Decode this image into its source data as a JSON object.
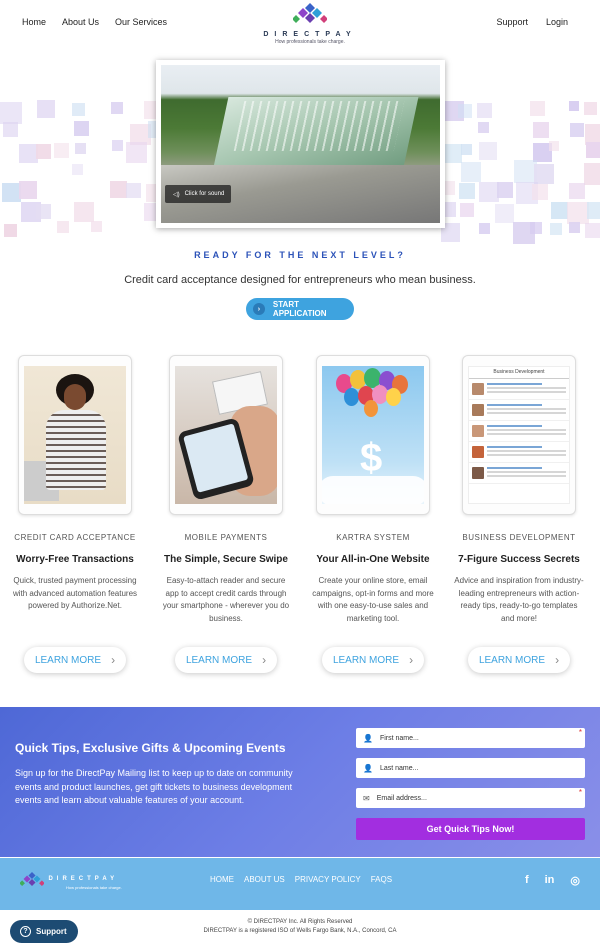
{
  "nav": {
    "left": [
      "Home",
      "About Us",
      "Our Services"
    ],
    "right": [
      "Support",
      "Login"
    ]
  },
  "logo": {
    "name": "DIRECTPAY",
    "tagline": "How professionals take charge."
  },
  "hero": {
    "sound_label": "Click for sound"
  },
  "tagline": {
    "ready": "READY FOR THE NEXT LEVEL?",
    "subhead": "Credit card acceptance designed for entrepreneurs who mean business.",
    "cta": "START APPLICATION"
  },
  "services": [
    {
      "category": "CREDIT CARD ACCEPTANCE",
      "title": "Worry-Free Transactions",
      "desc": "Quick, trusted payment processing with advanced automation features powered by Authorize.Net.",
      "button": "LEARN MORE"
    },
    {
      "category": "MOBILE PAYMENTS",
      "title": "The Simple, Secure Swipe",
      "desc": "Easy-to-attach reader and secure app to accept credit cards through your smartphone - wherever you do business.",
      "button": "LEARN MORE"
    },
    {
      "category": "KARTRA SYSTEM",
      "title": "Your All-in-One Website",
      "desc": "Create your online store, email campaigns, opt-in forms and more with one easy-to-use sales and marketing tool.",
      "button": "LEARN MORE"
    },
    {
      "category": "BUSINESS DEVELOPMENT",
      "title": "7-Figure Success Secrets",
      "desc": "Advice and inspiration from industry-leading entrepreneurs with action-ready tips, ready-to-go templates and more!",
      "button": "LEARN MORE"
    }
  ],
  "blog_preview_title": "Business Development",
  "newsletter": {
    "title": "Quick Tips, Exclusive Gifts & Upcoming Events",
    "text": "Sign up for the DirectPay Mailing list to keep up to date on community events and product launches, get gift tickets to business development events and learn about valuable features of your account.",
    "first_name": "First name...",
    "last_name": "Last name...",
    "email": "Email address...",
    "submit": "Get Quick Tips Now!"
  },
  "footer": {
    "links": [
      "HOME",
      "ABOUT US",
      "PRIVACY POLICY",
      "FAQS"
    ],
    "social": {
      "facebook": "f",
      "linkedin": "in",
      "instagram": "◎"
    }
  },
  "legal": {
    "line1": "© DIRECTPAY Inc. All Rights Reserved",
    "line2": "DIRECTPAY is a registered ISO of Wells Fargo Bank, N.A., Concord, CA"
  },
  "support_button": "Support",
  "colors": {
    "accent": "#3ea3df",
    "heading_blue": "#2b52b8",
    "submit_purple": "#a22ee0",
    "footer_blue": "#6fb7e8"
  }
}
